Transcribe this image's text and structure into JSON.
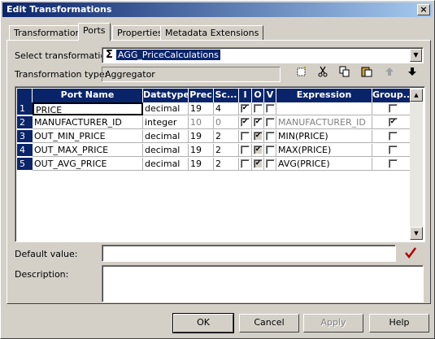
{
  "window": {
    "title": "Edit Transformations",
    "close": "×"
  },
  "tabs": [
    "Transformation",
    "Ports",
    "Properties",
    "Metadata Extensions"
  ],
  "select_transformation": {
    "label": "Select transformation:",
    "icon": "sigma-icon",
    "value": "AGG_PriceCalculations"
  },
  "transformation_type": {
    "label": "Transformation type:",
    "value": "Aggregator"
  },
  "toolbar": [
    "new-port-icon",
    "cut-icon",
    "copy-icon",
    "paste-icon",
    "move-up-icon",
    "move-down-icon"
  ],
  "grid": {
    "columns": [
      "Port Name",
      "Datatype",
      "Prec",
      "Sc...",
      "I",
      "O",
      "V",
      "Expression",
      "Group..."
    ],
    "rows": [
      {
        "num": "1",
        "name": "PRICE",
        "type": "decimal",
        "prec": "19",
        "scale": "4",
        "i": true,
        "o": false,
        "v": false,
        "expr": "",
        "group": false
      },
      {
        "num": "2",
        "name": "MANUFACTURER_ID",
        "type": "integer",
        "prec": "10",
        "scale": "0",
        "i": true,
        "o": true,
        "v": false,
        "expr": "MANUFACTURER_ID",
        "group": true
      },
      {
        "num": "3",
        "name": "OUT_MIN_PRICE",
        "type": "decimal",
        "prec": "19",
        "scale": "2",
        "i": false,
        "o": true,
        "v": false,
        "expr": "MIN(PRICE)",
        "group": false
      },
      {
        "num": "4",
        "name": "OUT_MAX_PRICE",
        "type": "decimal",
        "prec": "19",
        "scale": "2",
        "i": false,
        "o": true,
        "v": false,
        "expr": "MAX(PRICE)",
        "group": false
      },
      {
        "num": "5",
        "name": "OUT_AVG_PRICE",
        "type": "decimal",
        "prec": "19",
        "scale": "2",
        "i": false,
        "o": true,
        "v": false,
        "expr": "AVG(PRICE)",
        "group": false
      }
    ]
  },
  "default_value": {
    "label": "Default value:",
    "value": ""
  },
  "description": {
    "label": "Description:",
    "value": ""
  },
  "buttons": {
    "ok": "OK",
    "cancel": "Cancel",
    "apply": "Apply",
    "help": "Help"
  },
  "colors": {
    "selection": "#0a246a",
    "face": "#d4d0c8",
    "check": "#b00000"
  }
}
